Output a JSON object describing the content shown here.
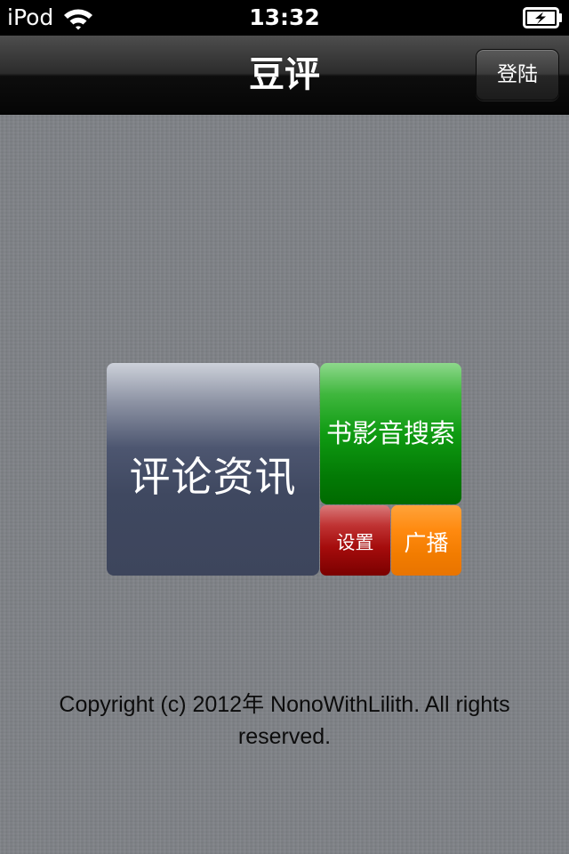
{
  "status_bar": {
    "carrier": "iPod",
    "time": "13:32",
    "icons": [
      "wifi-icon",
      "battery-charging-icon"
    ]
  },
  "nav": {
    "title": "豆评",
    "login_label": "登陆"
  },
  "tiles": {
    "reviews": "评论资讯",
    "search": "书影音搜索",
    "settings": "设置",
    "ads": "广播"
  },
  "colors": {
    "reviews_tile": "#3f4860",
    "search_tile": "#0f9b12",
    "settings_tile": "#a50c0c",
    "ads_tile": "#f27c00",
    "nav_bar": "#0d0d0d"
  },
  "footer": {
    "copyright": "Copyright (c) 2012年 NonoWithLilith. All rights reserved."
  }
}
